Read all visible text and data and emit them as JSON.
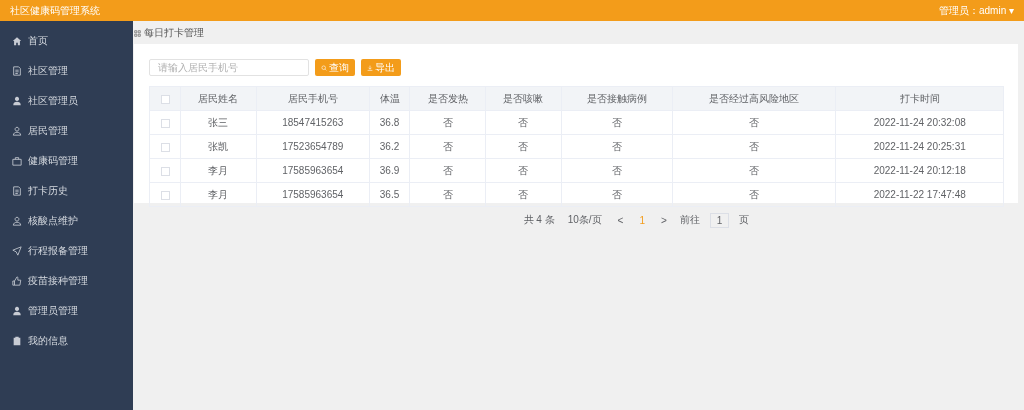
{
  "header": {
    "title": "社区健康码管理系统",
    "user": "管理员：admin",
    "caret": "▾"
  },
  "sidebar": {
    "items": [
      {
        "label": "首页",
        "kind": "home",
        "selected": false
      },
      {
        "label": "社区管理",
        "kind": "doc",
        "selected": false
      },
      {
        "label": "社区管理员",
        "kind": "person",
        "selected": false
      },
      {
        "label": "居民管理",
        "kind": "user",
        "selected": false
      },
      {
        "label": "健康码管理",
        "kind": "box",
        "selected": false
      },
      {
        "label": "打卡历史",
        "kind": "doc",
        "selected": false
      },
      {
        "label": "核酸点维护",
        "kind": "user",
        "selected": false
      },
      {
        "label": "行程报备管理",
        "kind": "send",
        "selected": false
      },
      {
        "label": "疫苗接种管理",
        "kind": "thumb",
        "selected": false
      },
      {
        "label": "管理员管理",
        "kind": "person",
        "selected": false
      },
      {
        "label": "我的信息",
        "kind": "clip",
        "selected": false
      }
    ]
  },
  "breadcrumb": "每日打卡管理",
  "search": {
    "placeholder": "请输入居民手机号"
  },
  "buttons": [
    {
      "label": "查询",
      "kind": "search"
    },
    {
      "label": "导出",
      "kind": "export"
    }
  ],
  "table": {
    "all_checked": false,
    "columns": [
      "居民姓名",
      "居民手机号",
      "体温",
      "是否发热",
      "是否咳嗽",
      "是否接触病例",
      "是否经过高风险地区",
      "打卡时间"
    ],
    "rows": [
      {
        "checked": false,
        "cells": [
          "张三",
          "18547415263",
          "36.8",
          "否",
          "否",
          "否",
          "否",
          "2022-11-24 20:32:08"
        ]
      },
      {
        "checked": false,
        "cells": [
          "张凯",
          "17523654789",
          "36.2",
          "否",
          "否",
          "否",
          "否",
          "2022-11-24 20:25:31"
        ]
      },
      {
        "checked": false,
        "cells": [
          "李月",
          "17585963654",
          "36.9",
          "否",
          "否",
          "否",
          "否",
          "2022-11-24 20:12:18"
        ]
      },
      {
        "checked": false,
        "cells": [
          "李月",
          "17585963654",
          "36.5",
          "否",
          "否",
          "否",
          "否",
          "2022-11-22 17:47:48"
        ]
      }
    ]
  },
  "pagination": {
    "total": "共 4 条",
    "page_size": "10条/页",
    "prev": "<",
    "pages": [
      {
        "label": "1",
        "selected": true
      }
    ],
    "next": ">",
    "goto": "前往",
    "page_input": "1",
    "page_unit": "页"
  }
}
